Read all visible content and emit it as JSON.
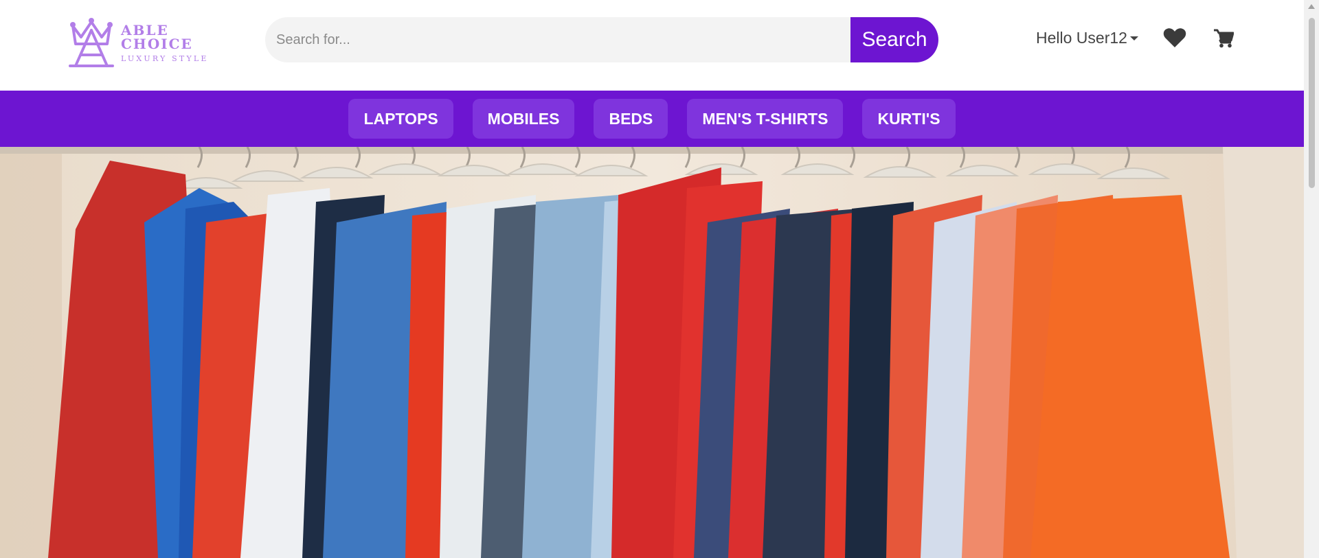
{
  "brand": {
    "name": "ABLE CHOICE",
    "tagline": "LUXURY STYLE",
    "color": "#b27ee8"
  },
  "search": {
    "placeholder": "Search for...",
    "value": "",
    "button_label": "Search"
  },
  "user": {
    "greeting": "Hello User12"
  },
  "icons": {
    "wishlist": "heart-icon",
    "cart": "cart-icon",
    "user_menu": "caret-down-icon"
  },
  "nav": {
    "items": [
      {
        "label": "LAPTOPS"
      },
      {
        "label": "MOBILES"
      },
      {
        "label": "BEDS"
      },
      {
        "label": "MEN'S T-SHIRTS"
      },
      {
        "label": "KURTI'S"
      }
    ]
  },
  "colors": {
    "accent": "#6d15d1",
    "nav_item_bg": "#7f34dd"
  }
}
